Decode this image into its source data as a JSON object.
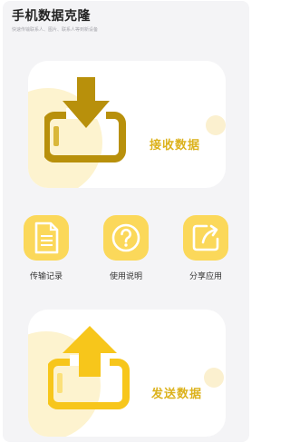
{
  "header": {
    "title": "手机数据克隆",
    "subtitle": "快速传输联系人、图片、联系人等到新设备"
  },
  "receive_card": {
    "label": "接收数据",
    "icon": "download-to-device-icon"
  },
  "send_card": {
    "label": "发送数据",
    "icon": "upload-from-device-icon"
  },
  "actions": [
    {
      "label": "传输记录",
      "icon": "document-icon"
    },
    {
      "label": "使用说明",
      "icon": "question-icon"
    },
    {
      "label": "分享应用",
      "icon": "share-icon"
    }
  ],
  "colors": {
    "accent": "#dcb21c",
    "tile": "#fbd85a",
    "download_icon": "#b8900b",
    "upload_icon": "#f7c61b",
    "background": "#f4f4f6"
  }
}
